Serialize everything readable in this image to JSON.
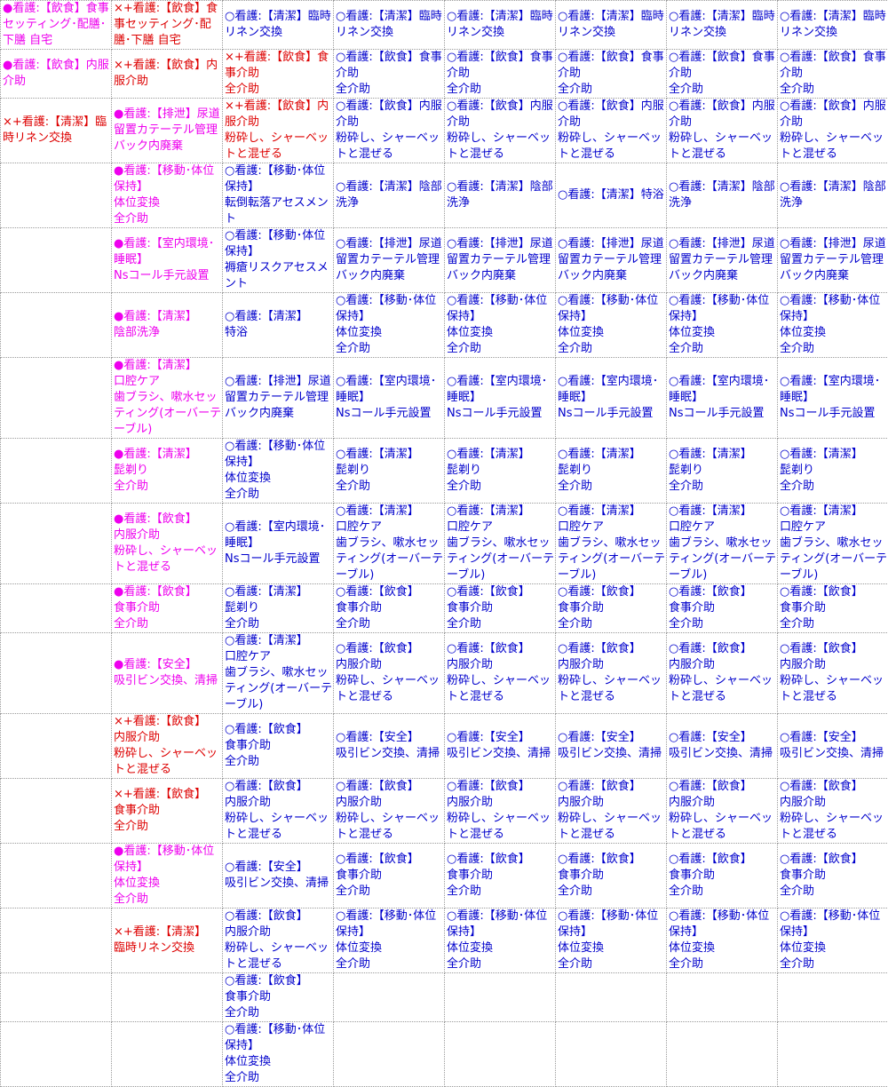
{
  "colors": {
    "planned": "#0000cc",
    "done": "#ee00ee",
    "cancelled": "#dd0000",
    "grid": "#9a9a9a",
    "background": "#ffffff"
  },
  "rows": [
    [
      {
        "text": "●看護:【飲食】食事セッティング･配膳･下膳 自宅",
        "status": "done"
      },
      {
        "text": "×+看護:【飲食】食事セッティング･配膳･下膳 自宅",
        "status": "cancelled"
      },
      {
        "text": "○看護:【清潔】臨時リネン交換",
        "status": "planned"
      },
      {
        "text": "○看護:【清潔】臨時リネン交換",
        "status": "planned"
      },
      {
        "text": "○看護:【清潔】臨時リネン交換",
        "status": "planned"
      },
      {
        "text": "○看護:【清潔】臨時リネン交換",
        "status": "planned"
      },
      {
        "text": "○看護:【清潔】臨時リネン交換",
        "status": "planned"
      },
      {
        "text": "○看護:【清潔】臨時リネン交換",
        "status": "planned"
      }
    ],
    [
      {
        "text": "●看護:【飲食】内服介助",
        "status": "done"
      },
      {
        "text": "×+看護:【飲食】内服介助",
        "status": "cancelled"
      },
      {
        "text": "×+看護:【飲食】食事介助\n全介助",
        "status": "cancelled"
      },
      {
        "text": "○看護:【飲食】食事介助\n全介助",
        "status": "planned"
      },
      {
        "text": "○看護:【飲食】食事介助\n全介助",
        "status": "planned"
      },
      {
        "text": "○看護:【飲食】食事介助\n全介助",
        "status": "planned"
      },
      {
        "text": "○看護:【飲食】食事介助\n全介助",
        "status": "planned"
      },
      {
        "text": "○看護:【飲食】食事介助\n全介助",
        "status": "planned"
      }
    ],
    [
      {
        "text": "×+看護:【清潔】臨時リネン交換",
        "status": "cancelled"
      },
      {
        "text": "●看護:【排泄】尿道留置カテーテル管理\nバック内廃棄",
        "status": "done"
      },
      {
        "text": "×+看護:【飲食】内服介助\n粉砕し、シャーベットと混ぜる",
        "status": "cancelled"
      },
      {
        "text": "○看護:【飲食】内服介助\n粉砕し、シャーベットと混ぜる",
        "status": "planned"
      },
      {
        "text": "○看護:【飲食】内服介助\n粉砕し、シャーベットと混ぜる",
        "status": "planned"
      },
      {
        "text": "○看護:【飲食】内服介助\n粉砕し、シャーベットと混ぜる",
        "status": "planned"
      },
      {
        "text": "○看護:【飲食】内服介助\n粉砕し、シャーベットと混ぜる",
        "status": "planned"
      },
      {
        "text": "○看護:【飲食】内服介助\n粉砕し、シャーベットと混ぜる",
        "status": "planned"
      }
    ],
    [
      {
        "text": "",
        "status": "planned"
      },
      {
        "text": "●看護:【移動･体位保持】\n体位変換\n全介助",
        "status": "done"
      },
      {
        "text": "○看護:【移動･体位保持】\n転倒転落アセスメント",
        "status": "planned"
      },
      {
        "text": "○看護:【清潔】陰部洗浄",
        "status": "planned"
      },
      {
        "text": "○看護:【清潔】陰部洗浄",
        "status": "planned"
      },
      {
        "text": "○看護:【清潔】特浴",
        "status": "planned"
      },
      {
        "text": "○看護:【清潔】陰部洗浄",
        "status": "planned"
      },
      {
        "text": "○看護:【清潔】陰部洗浄",
        "status": "planned"
      }
    ],
    [
      {
        "text": "",
        "status": "planned"
      },
      {
        "text": "●看護:【室内環境･睡眠】\nNsコール手元設置",
        "status": "done"
      },
      {
        "text": "○看護:【移動･体位保持】\n褥瘡リスクアセスメント",
        "status": "planned"
      },
      {
        "text": "○看護:【排泄】尿道留置カテーテル管理\nバック内廃棄",
        "status": "planned"
      },
      {
        "text": "○看護:【排泄】尿道留置カテーテル管理\nバック内廃棄",
        "status": "planned"
      },
      {
        "text": "○看護:【排泄】尿道留置カテーテル管理\nバック内廃棄",
        "status": "planned"
      },
      {
        "text": "○看護:【排泄】尿道留置カテーテル管理\nバック内廃棄",
        "status": "planned"
      },
      {
        "text": "○看護:【排泄】尿道留置カテーテル管理\nバック内廃棄",
        "status": "planned"
      }
    ],
    [
      {
        "text": "",
        "status": "planned"
      },
      {
        "text": "●看護:【清潔】\n陰部洗浄",
        "status": "done"
      },
      {
        "text": "○看護:【清潔】\n特浴",
        "status": "planned"
      },
      {
        "text": "○看護:【移動･体位保持】\n体位変換\n全介助",
        "status": "planned"
      },
      {
        "text": "○看護:【移動･体位保持】\n体位変換\n全介助",
        "status": "planned"
      },
      {
        "text": "○看護:【移動･体位保持】\n体位変換\n全介助",
        "status": "planned"
      },
      {
        "text": "○看護:【移動･体位保持】\n体位変換\n全介助",
        "status": "planned"
      },
      {
        "text": "○看護:【移動･体位保持】\n体位変換\n全介助",
        "status": "planned"
      }
    ],
    [
      {
        "text": "",
        "status": "planned"
      },
      {
        "text": "●看護:【清潔】\n口腔ケア\n歯ブラシ、嗽水セッティング(オーバーテーブル)",
        "status": "done"
      },
      {
        "text": "○看護:【排泄】尿道留置カテーテル管理\nバック内廃棄",
        "status": "planned"
      },
      {
        "text": "○看護:【室内環境･睡眠】\nNsコール手元設置",
        "status": "planned"
      },
      {
        "text": "○看護:【室内環境･睡眠】\nNsコール手元設置",
        "status": "planned"
      },
      {
        "text": "○看護:【室内環境･睡眠】\nNsコール手元設置",
        "status": "planned"
      },
      {
        "text": "○看護:【室内環境･睡眠】\nNsコール手元設置",
        "status": "planned"
      },
      {
        "text": "○看護:【室内環境･睡眠】\nNsコール手元設置",
        "status": "planned"
      }
    ],
    [
      {
        "text": "",
        "status": "planned"
      },
      {
        "text": "●看護:【清潔】\n髭剃り\n全介助",
        "status": "done"
      },
      {
        "text": "○看護:【移動･体位保持】\n体位変換\n全介助",
        "status": "planned"
      },
      {
        "text": "○看護:【清潔】\n髭剃り\n全介助",
        "status": "planned"
      },
      {
        "text": "○看護:【清潔】\n髭剃り\n全介助",
        "status": "planned"
      },
      {
        "text": "○看護:【清潔】\n髭剃り\n全介助",
        "status": "planned"
      },
      {
        "text": "○看護:【清潔】\n髭剃り\n全介助",
        "status": "planned"
      },
      {
        "text": "○看護:【清潔】\n髭剃り\n全介助",
        "status": "planned"
      }
    ],
    [
      {
        "text": "",
        "status": "planned"
      },
      {
        "text": "●看護:【飲食】\n内服介助\n粉砕し、シャーベットと混ぜる",
        "status": "done"
      },
      {
        "text": "○看護:【室内環境･睡眠】\nNsコール手元設置",
        "status": "planned"
      },
      {
        "text": "○看護:【清潔】\n口腔ケア\n歯ブラシ、嗽水セッティング(オーバーテーブル)",
        "status": "planned"
      },
      {
        "text": "○看護:【清潔】\n口腔ケア\n歯ブラシ、嗽水セッティング(オーバーテーブル)",
        "status": "planned"
      },
      {
        "text": "○看護:【清潔】\n口腔ケア\n歯ブラシ、嗽水セッティング(オーバーテーブル)",
        "status": "planned"
      },
      {
        "text": "○看護:【清潔】\n口腔ケア\n歯ブラシ、嗽水セッティング(オーバーテーブル)",
        "status": "planned"
      },
      {
        "text": "○看護:【清潔】\n口腔ケア\n歯ブラシ、嗽水セッティング(オーバーテーブル)",
        "status": "planned"
      }
    ],
    [
      {
        "text": "",
        "status": "planned"
      },
      {
        "text": "●看護:【飲食】\n食事介助\n全介助",
        "status": "done"
      },
      {
        "text": "○看護:【清潔】\n髭剃り\n全介助",
        "status": "planned"
      },
      {
        "text": "○看護:【飲食】\n食事介助\n全介助",
        "status": "planned"
      },
      {
        "text": "○看護:【飲食】\n食事介助\n全介助",
        "status": "planned"
      },
      {
        "text": "○看護:【飲食】\n食事介助\n全介助",
        "status": "planned"
      },
      {
        "text": "○看護:【飲食】\n食事介助\n全介助",
        "status": "planned"
      },
      {
        "text": "○看護:【飲食】\n食事介助\n全介助",
        "status": "planned"
      }
    ],
    [
      {
        "text": "",
        "status": "planned"
      },
      {
        "text": "●看護:【安全】\n吸引ビン交換、清掃",
        "status": "done"
      },
      {
        "text": "○看護:【清潔】\n口腔ケア\n歯ブラシ、嗽水セッティング(オーバーテーブル)",
        "status": "planned"
      },
      {
        "text": "○看護:【飲食】\n内服介助\n粉砕し、シャーベットと混ぜる",
        "status": "planned"
      },
      {
        "text": "○看護:【飲食】\n内服介助\n粉砕し、シャーベットと混ぜる",
        "status": "planned"
      },
      {
        "text": "○看護:【飲食】\n内服介助\n粉砕し、シャーベットと混ぜる",
        "status": "planned"
      },
      {
        "text": "○看護:【飲食】\n内服介助\n粉砕し、シャーベットと混ぜる",
        "status": "planned"
      },
      {
        "text": "○看護:【飲食】\n内服介助\n粉砕し、シャーベットと混ぜる",
        "status": "planned"
      }
    ],
    [
      {
        "text": "",
        "status": "planned"
      },
      {
        "text": "×+看護:【飲食】\n内服介助\n粉砕し、シャーベットと混ぜる",
        "status": "cancelled"
      },
      {
        "text": "○看護:【飲食】\n食事介助\n全介助",
        "status": "planned"
      },
      {
        "text": "○看護:【安全】\n吸引ビン交換、清掃",
        "status": "planned"
      },
      {
        "text": "○看護:【安全】\n吸引ビン交換、清掃",
        "status": "planned"
      },
      {
        "text": "○看護:【安全】\n吸引ビン交換、清掃",
        "status": "planned"
      },
      {
        "text": "○看護:【安全】\n吸引ビン交換、清掃",
        "status": "planned"
      },
      {
        "text": "○看護:【安全】\n吸引ビン交換、清掃",
        "status": "planned"
      }
    ],
    [
      {
        "text": "",
        "status": "planned"
      },
      {
        "text": "×+看護:【飲食】\n食事介助\n全介助",
        "status": "cancelled"
      },
      {
        "text": "○看護:【飲食】\n内服介助\n粉砕し、シャーベットと混ぜる",
        "status": "planned"
      },
      {
        "text": "○看護:【飲食】\n内服介助\n粉砕し、シャーベットと混ぜる",
        "status": "planned"
      },
      {
        "text": "○看護:【飲食】\n内服介助\n粉砕し、シャーベットと混ぜる",
        "status": "planned"
      },
      {
        "text": "○看護:【飲食】\n内服介助\n粉砕し、シャーベットと混ぜる",
        "status": "planned"
      },
      {
        "text": "○看護:【飲食】\n内服介助\n粉砕し、シャーベットと混ぜる",
        "status": "planned"
      },
      {
        "text": "○看護:【飲食】\n内服介助\n粉砕し、シャーベットと混ぜる",
        "status": "planned"
      }
    ],
    [
      {
        "text": "",
        "status": "planned"
      },
      {
        "text": "●看護:【移動･体位保持】\n体位変換\n全介助",
        "status": "done"
      },
      {
        "text": "○看護:【安全】\n吸引ビン交換、清掃",
        "status": "planned"
      },
      {
        "text": "○看護:【飲食】\n食事介助\n全介助",
        "status": "planned"
      },
      {
        "text": "○看護:【飲食】\n食事介助\n全介助",
        "status": "planned"
      },
      {
        "text": "○看護:【飲食】\n食事介助\n全介助",
        "status": "planned"
      },
      {
        "text": "○看護:【飲食】\n食事介助\n全介助",
        "status": "planned"
      },
      {
        "text": "○看護:【飲食】\n食事介助\n全介助",
        "status": "planned"
      }
    ],
    [
      {
        "text": "",
        "status": "planned"
      },
      {
        "text": "×+看護:【清潔】\n臨時リネン交換",
        "status": "cancelled"
      },
      {
        "text": "○看護:【飲食】\n内服介助\n粉砕し、シャーベットと混ぜる",
        "status": "planned"
      },
      {
        "text": "○看護:【移動･体位保持】\n体位変換\n全介助",
        "status": "planned"
      },
      {
        "text": "○看護:【移動･体位保持】\n体位変換\n全介助",
        "status": "planned"
      },
      {
        "text": "○看護:【移動･体位保持】\n体位変換\n全介助",
        "status": "planned"
      },
      {
        "text": "○看護:【移動･体位保持】\n体位変換\n全介助",
        "status": "planned"
      },
      {
        "text": "○看護:【移動･体位保持】\n体位変換\n全介助",
        "status": "planned"
      }
    ],
    [
      {
        "text": "",
        "status": "planned"
      },
      {
        "text": "",
        "status": "planned"
      },
      {
        "text": "○看護:【飲食】\n食事介助\n全介助",
        "status": "planned"
      },
      {
        "text": "",
        "status": "planned"
      },
      {
        "text": "",
        "status": "planned"
      },
      {
        "text": "",
        "status": "planned"
      },
      {
        "text": "",
        "status": "planned"
      },
      {
        "text": "",
        "status": "planned"
      }
    ],
    [
      {
        "text": "",
        "status": "planned"
      },
      {
        "text": "",
        "status": "planned"
      },
      {
        "text": "○看護:【移動･体位保持】\n体位変換\n全介助",
        "status": "planned"
      },
      {
        "text": "",
        "status": "planned"
      },
      {
        "text": "",
        "status": "planned"
      },
      {
        "text": "",
        "status": "planned"
      },
      {
        "text": "",
        "status": "planned"
      },
      {
        "text": "",
        "status": "planned"
      }
    ]
  ]
}
